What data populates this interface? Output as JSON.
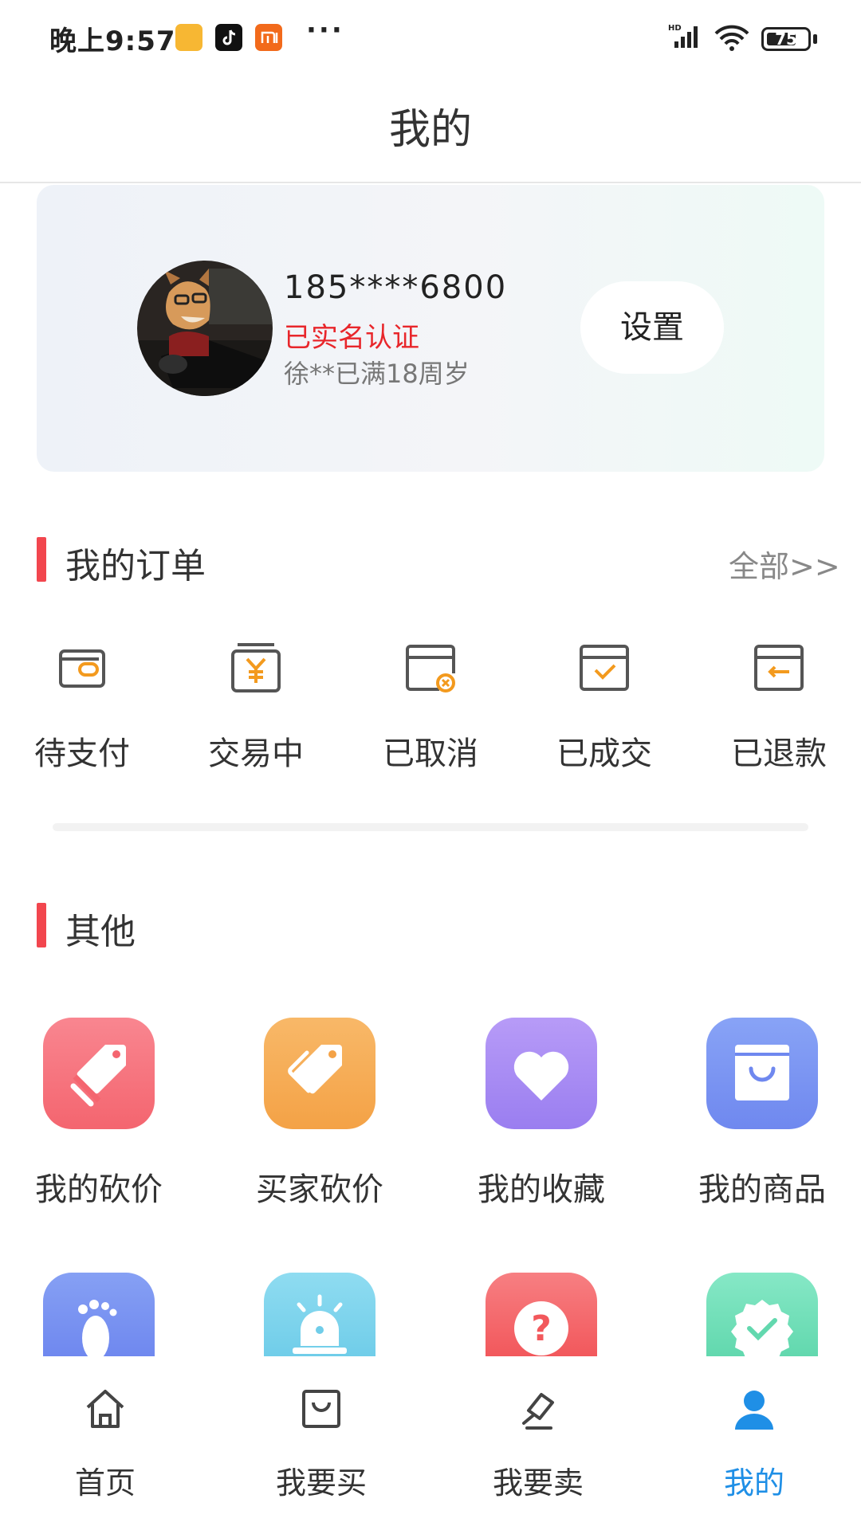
{
  "status_bar": {
    "time": "晚上9:57",
    "dots": "···",
    "battery": "75",
    "battery_level": 0.75
  },
  "header": {
    "title": "我的"
  },
  "profile": {
    "phone": "185****6800",
    "verified": "已实名认证",
    "age_info": "徐**已满18周岁",
    "settings_label": "设置"
  },
  "orders": {
    "title": "我的订单",
    "all_link": "全部>>",
    "items": [
      {
        "label": "待支付",
        "icon": "wallet-icon"
      },
      {
        "label": "交易中",
        "icon": "yen-box-icon"
      },
      {
        "label": "已取消",
        "icon": "box-cancel-icon"
      },
      {
        "label": "已成交",
        "icon": "box-check-icon"
      },
      {
        "label": "已退款",
        "icon": "box-refund-icon"
      }
    ]
  },
  "others": {
    "title": "其他",
    "items": [
      {
        "label": "我的砍价",
        "icon": "tag-slash-icon",
        "color": "#f6707a"
      },
      {
        "label": "买家砍价",
        "icon": "tags-icon",
        "color": "#f6aa55"
      },
      {
        "label": "我的收藏",
        "icon": "heart-icon",
        "color": "#a489f2"
      },
      {
        "label": "我的商品",
        "icon": "shopping-bag-icon",
        "color": "#7a93f3"
      },
      {
        "label": "",
        "icon": "footprint-icon",
        "color": "#7590ee"
      },
      {
        "label": "",
        "icon": "alarm-light-icon",
        "color": "#7fd4ee"
      },
      {
        "label": "",
        "icon": "question-icon",
        "color": "#f56a6c"
      },
      {
        "label": "",
        "icon": "verified-badge-icon",
        "color": "#6fe0b9"
      }
    ]
  },
  "bottom_nav": {
    "items": [
      {
        "label": "首页",
        "icon": "home-icon"
      },
      {
        "label": "我要买",
        "icon": "bag-icon"
      },
      {
        "label": "我要卖",
        "icon": "gavel-icon"
      },
      {
        "label": "我的",
        "icon": "user-icon",
        "active": true
      }
    ],
    "active_color": "#1f8fe6"
  }
}
